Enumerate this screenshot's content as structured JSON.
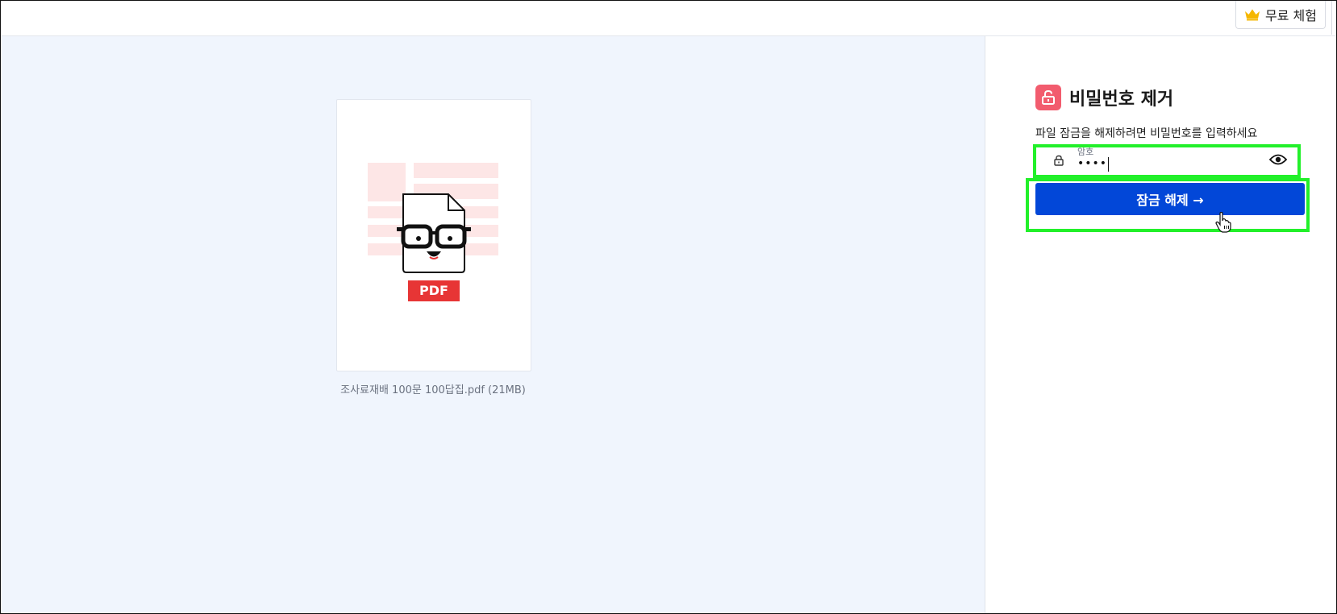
{
  "topbar": {
    "trial_label": "무료 체험",
    "trial_icon": "crown-icon",
    "accent": "#f5b700"
  },
  "preview": {
    "file_badge": "PDF",
    "file_name": "조사료재배 100문 100답집.pdf (21MB)"
  },
  "panel": {
    "title": "비밀번호 제거",
    "title_icon": "unlock-icon",
    "instruction": "파일 잠금을 해제하려면 비밀번호를 입력하세요",
    "password": {
      "label": "암호",
      "value": "••••"
    },
    "unlock_button": {
      "label": "잠금 해제 →",
      "color": "#0247d8"
    }
  },
  "colors": {
    "highlight": "#22f02a",
    "preview_bg": "#f0f5fd",
    "pdf_badge": "#e73535",
    "tool_icon_bg": "#f25c6e"
  }
}
